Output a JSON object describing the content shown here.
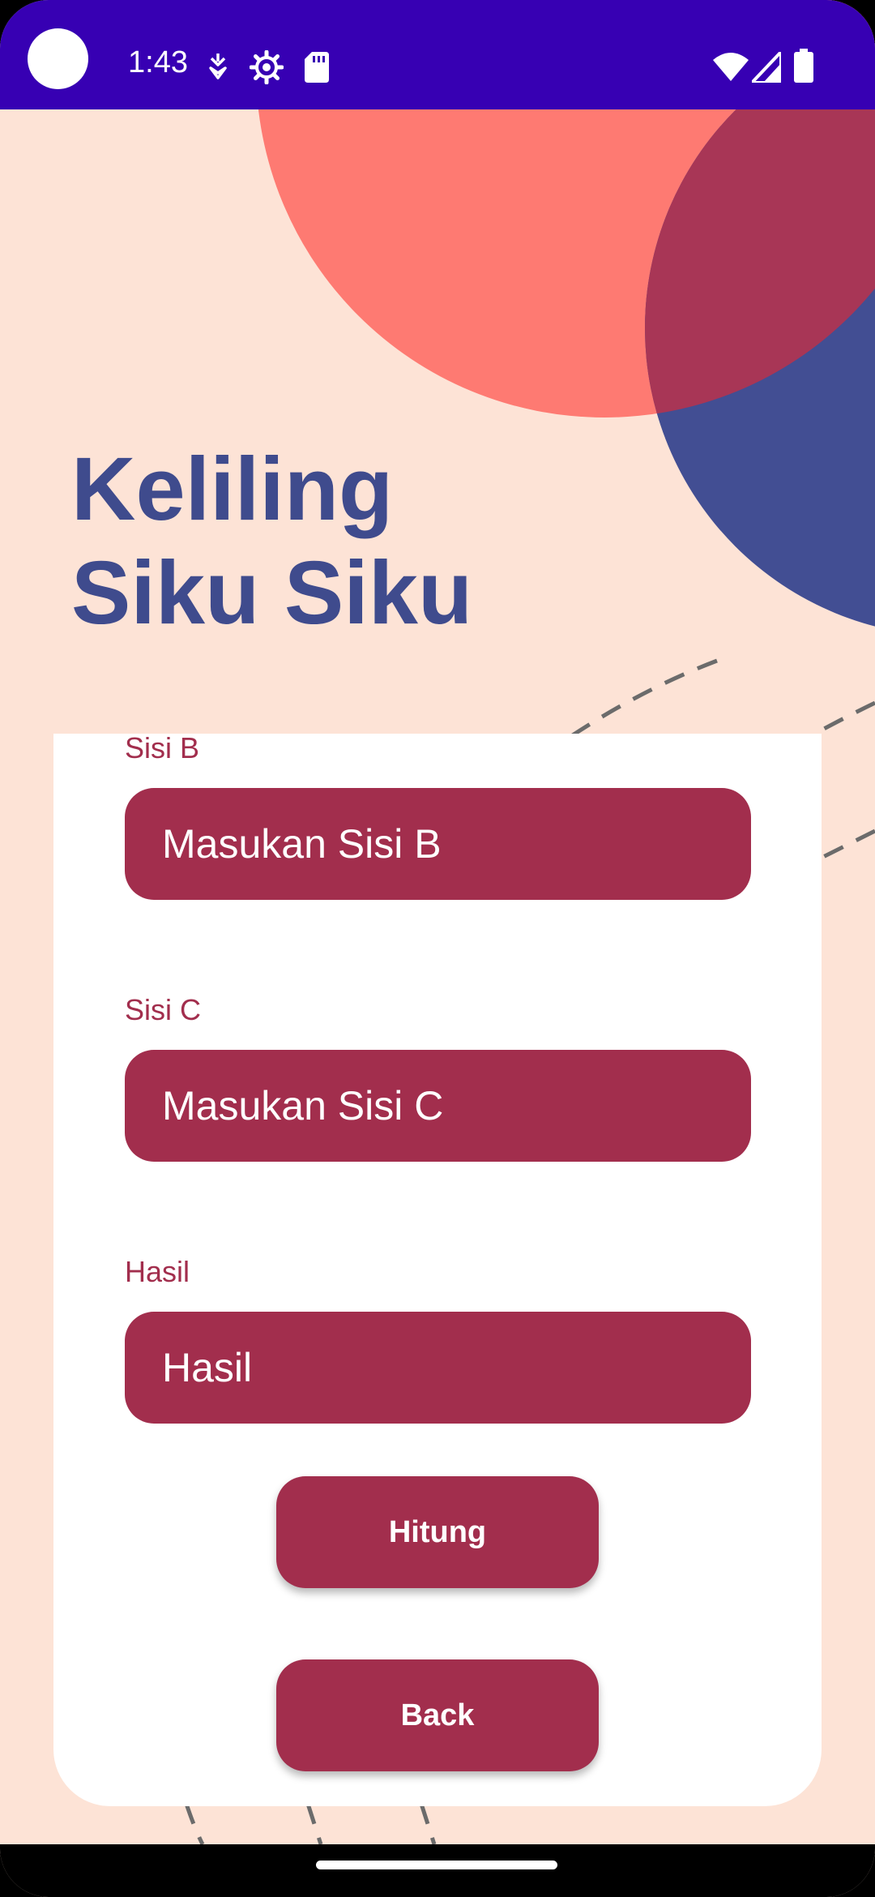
{
  "status_bar": {
    "time": "1:43",
    "icons": [
      "notification-icon",
      "settings-gear-icon",
      "sd-card-icon",
      "wifi-icon",
      "signal-icon",
      "battery-icon"
    ]
  },
  "page": {
    "title_line1": "Keliling",
    "title_line2": "Siku Siku"
  },
  "form": {
    "sisi_b": {
      "label": "Sisi B",
      "placeholder": "Masukan Sisi B"
    },
    "sisi_c": {
      "label": "Sisi C",
      "placeholder": "Masukan Sisi C"
    },
    "hasil": {
      "label": "Hasil",
      "placeholder": "Hasil"
    }
  },
  "buttons": {
    "hitung": "Hitung",
    "back": "Back"
  },
  "colors": {
    "status_bar": "#3700b3",
    "background": "#fde3d6",
    "accent": "#a22e4d",
    "title": "#3f4b8d",
    "coral": "#fe7a72",
    "navy": "#424e93"
  }
}
